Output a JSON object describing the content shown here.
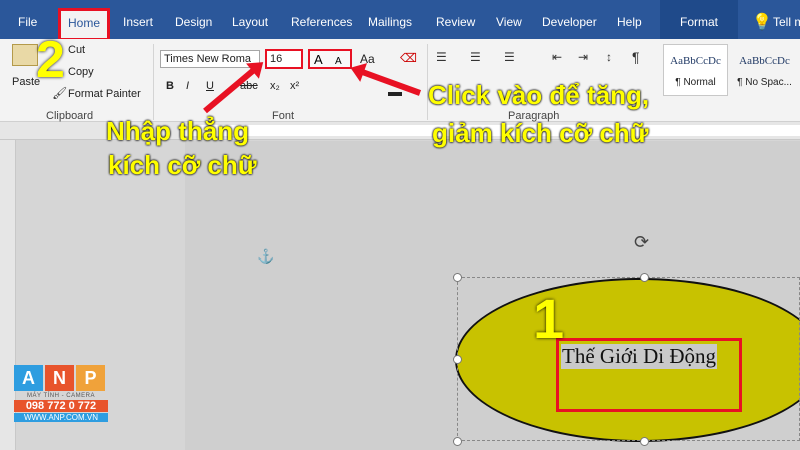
{
  "tabs": [
    {
      "label": "File"
    },
    {
      "label": "Home"
    },
    {
      "label": "Insert"
    },
    {
      "label": "Design"
    },
    {
      "label": "Layout"
    },
    {
      "label": "References"
    },
    {
      "label": "Mailings"
    },
    {
      "label": "Review"
    },
    {
      "label": "View"
    },
    {
      "label": "Developer"
    },
    {
      "label": "Help"
    },
    {
      "label": "Format"
    }
  ],
  "tell_me": "Tell m",
  "clipboard": {
    "paste": "Paste",
    "cut": "Cut",
    "copy": "Copy",
    "format_painter": "Format Painter",
    "label": "Clipboard"
  },
  "font": {
    "name": "Times New Roma",
    "size": "16",
    "grow": "A",
    "shrink": "A",
    "case": "Aa",
    "label": "Font",
    "bold": "B",
    "italic": "I",
    "underline": "U",
    "strike": "abc",
    "sub": "x₂",
    "sup": "x²"
  },
  "paragraph": {
    "label": "Paragraph"
  },
  "styles": [
    {
      "preview": "AaBbCcDc",
      "name": "¶ Normal"
    },
    {
      "preview": "AaBbCcDc",
      "name": "¶ No Spac..."
    }
  ],
  "annotations": {
    "step1": "1",
    "step2": "2",
    "type_size": [
      "Nhập thẳng",
      "kích cỡ chữ"
    ],
    "click_size": [
      "Click vào để tăng,",
      "giảm kích cỡ chữ"
    ]
  },
  "document": {
    "text": "Thế Giới Di Động"
  },
  "logo": {
    "letters": [
      "A",
      "N",
      "P"
    ],
    "tagline": "MÁY TÍNH - CAMERA",
    "phone": "098 772 0 772",
    "web": "WWW.ANP.COM.VN"
  },
  "colors": {
    "ribbon": "#2b579a",
    "highlight": "#e81123",
    "annotation": "#ffff00",
    "shape_fill": "#c8c200"
  }
}
